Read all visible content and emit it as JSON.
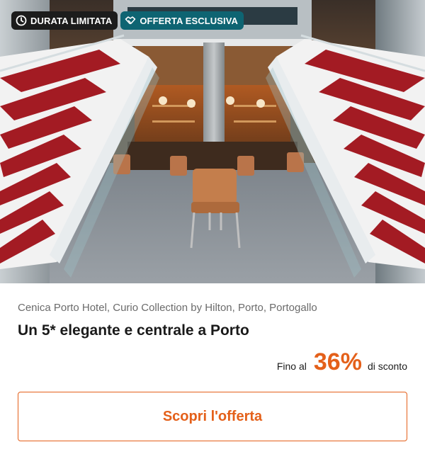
{
  "badges": {
    "limited": {
      "label": "DURATA LIMITATA",
      "icon": "clock-icon"
    },
    "exclusive": {
      "label": "OFFERTA ESCLUSIVA",
      "icon": "handshake-icon"
    }
  },
  "hero": {
    "icon": "hotel-photo"
  },
  "offer": {
    "location": "Cenica Porto Hotel, Curio Collection by Hilton, Porto, Portogallo",
    "title": "Un 5* elegante e centrale a Porto",
    "discount_prefix": "Fino al",
    "discount_value": "36%",
    "discount_suffix": "di sconto",
    "cta_label": "Scopri l'offerta"
  },
  "colors": {
    "accent": "#e4601a",
    "badge_dark": "#1c1c1c",
    "badge_teal": "#0e6472"
  }
}
